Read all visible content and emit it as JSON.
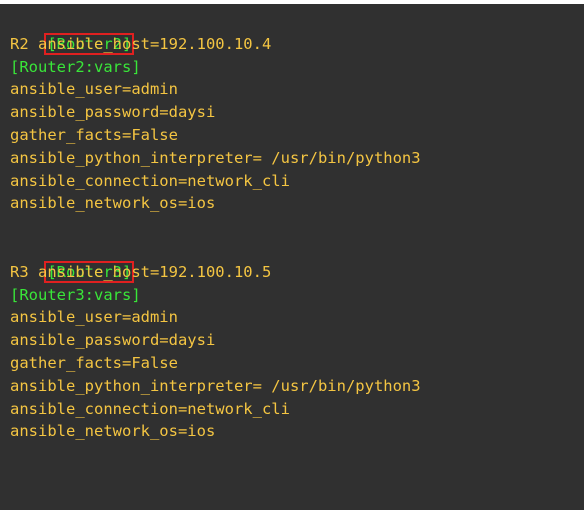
{
  "colors": {
    "background": "#303030",
    "section_header": "#39e639",
    "text": "#f4c542",
    "highlight_box": "#e02020"
  },
  "inventory": {
    "groups": [
      {
        "header": "[Router2]",
        "host_line": "R2 ansible_host=192.100.10.4",
        "vars_header": "[Router2:vars]",
        "vars": [
          "ansible_user=admin",
          "ansible_password=daysi",
          "gather_facts=False",
          "ansible_python_interpreter= /usr/bin/python3",
          "ansible_connection=network_cli",
          "ansible_network_os=ios"
        ]
      },
      {
        "header": "[Router3]",
        "host_line": "R3 ansible_host=192.100.10.5",
        "vars_header": "[Router3:vars]",
        "vars": [
          "ansible_user=admin",
          "ansible_password=daysi",
          "gather_facts=False",
          "ansible_python_interpreter= /usr/bin/python3",
          "ansible_connection=network_cli",
          "ansible_network_os=ios"
        ]
      }
    ]
  }
}
